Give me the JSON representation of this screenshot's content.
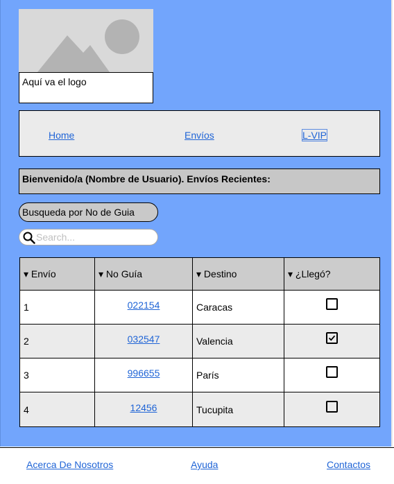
{
  "logo": {
    "caption": "Aquí va el logo"
  },
  "nav": {
    "items": [
      {
        "label": "Home"
      },
      {
        "label": "Envíos"
      },
      {
        "label": "L-VIP"
      }
    ]
  },
  "welcome": "Bienvenido/a (Nombre de Usuario). Envíos Recientes:",
  "search_by_guide": "Busqueda por No de Guia",
  "search": {
    "placeholder": "Search...",
    "value": ""
  },
  "table": {
    "headers": [
      "▾ Envío",
      "▾ No Guía",
      "▾ Destino",
      "▾ ¿Llegó?"
    ],
    "rows": [
      {
        "num": "1",
        "guide": "022154",
        "dest": "Caracas",
        "arrived": false
      },
      {
        "num": "2",
        "guide": "032547",
        "dest": "Valencia",
        "arrived": true
      },
      {
        "num": "3",
        "guide": "996655",
        "dest": "París",
        "arrived": false
      },
      {
        "num": "4",
        "guide": "12456",
        "dest": "Tucupita",
        "arrived": false
      }
    ]
  },
  "footer": {
    "links": [
      {
        "label": "Acerca De Nosotros"
      },
      {
        "label": "Ayuda"
      },
      {
        "label": "Contactos"
      }
    ]
  },
  "colors": {
    "page_bg": "#72a5fc",
    "link": "#1f64d6",
    "panel": "#ebebeb",
    "header_cell": "#cccccc"
  },
  "icons": {
    "search": "search-icon",
    "logo": "image-placeholder-icon"
  }
}
